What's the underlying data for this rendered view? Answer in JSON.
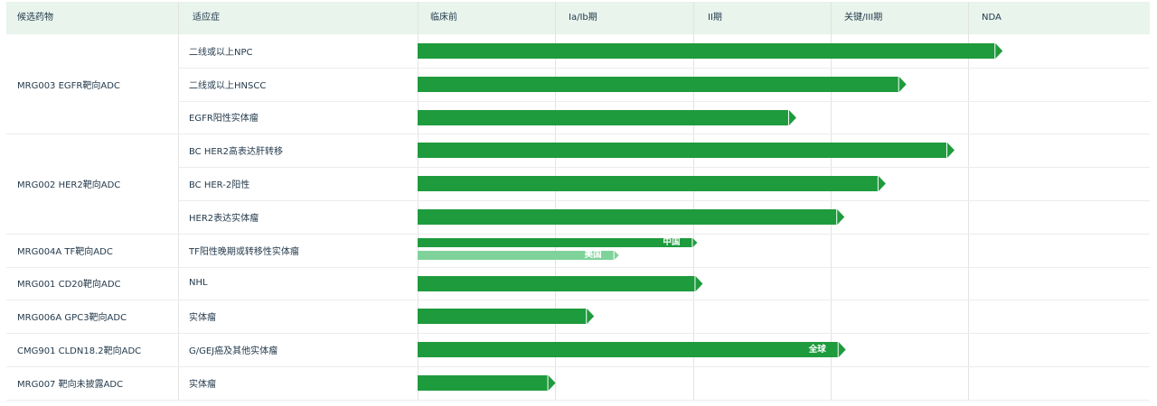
{
  "header": {
    "drug": "候选药物",
    "indication": "适应症",
    "phases": [
      "临床前",
      "Ia/Ib期",
      "II期",
      "关键/III期",
      "NDA"
    ]
  },
  "colors": {
    "primary_bar": "#1e9b3d",
    "secondary_bar": "#7fd39a",
    "header_bg": "#e8f4ec"
  },
  "drugs": [
    {
      "name": "MRG003 EGFR靶向ADC",
      "indications": [
        "二线或以上NPC",
        "二线或以上HNSCC",
        "EGFR阳性实体瘤"
      ]
    },
    {
      "name": "MRG002 HER2靶向ADC",
      "indications": [
        "BC HER2高表达肝转移",
        "BC HER-2阳性",
        "HER2表达实体瘤"
      ]
    },
    {
      "name": "MRG004A TF靶向ADC",
      "indications": [
        "TF阳性晚期或转移性实体瘤"
      ]
    },
    {
      "name": "MRG001 CD20靶向ADC",
      "indications": [
        "NHL"
      ]
    },
    {
      "name": "MRG006A GPC3靶向ADC",
      "indications": [
        "实体瘤"
      ]
    },
    {
      "name": "CMG901 CLDN18.2靶向ADC",
      "indications": [
        "G/GEJ癌及其他实体瘤"
      ]
    },
    {
      "name": "MRG007 靶向未披露ADC",
      "indications": [
        "实体瘤"
      ]
    }
  ],
  "chart_data": {
    "type": "bar",
    "orientation": "horizontal",
    "stages": [
      "临床前",
      "Ia/Ib期",
      "II期",
      "关键/III期",
      "NDA"
    ],
    "note_unit": "progress measured in stage columns from start of 临床前 (0 to 5)",
    "rows": [
      {
        "drug": "MRG003 EGFR靶向ADC",
        "indication": "二线或以上NPC",
        "bars": [
          {
            "progress": 4.2,
            "series": "primary",
            "label": ""
          }
        ]
      },
      {
        "drug": "MRG003 EGFR靶向ADC",
        "indication": "二线或以上HNSCC",
        "bars": [
          {
            "progress": 3.5,
            "series": "primary",
            "label": ""
          }
        ]
      },
      {
        "drug": "MRG003 EGFR靶向ADC",
        "indication": "EGFR阳性实体瘤",
        "bars": [
          {
            "progress": 2.7,
            "series": "primary",
            "label": ""
          }
        ]
      },
      {
        "drug": "MRG002 HER2靶向ADC",
        "indication": "BC HER2高表达肝转移",
        "bars": [
          {
            "progress": 3.85,
            "series": "primary",
            "label": ""
          }
        ]
      },
      {
        "drug": "MRG002 HER2靶向ADC",
        "indication": "BC HER-2阳性",
        "bars": [
          {
            "progress": 3.35,
            "series": "primary",
            "label": ""
          }
        ]
      },
      {
        "drug": "MRG002 HER2靶向ADC",
        "indication": "HER2表达实体瘤",
        "bars": [
          {
            "progress": 3.05,
            "series": "primary",
            "label": ""
          }
        ]
      },
      {
        "drug": "MRG004A TF靶向ADC",
        "indication": "TF阳性晚期或转移性实体瘤",
        "bars": [
          {
            "progress": 2.0,
            "series": "primary",
            "label": "中国"
          },
          {
            "progress": 1.43,
            "series": "secondary",
            "label": "美国"
          }
        ]
      },
      {
        "drug": "MRG001 CD20靶向ADC",
        "indication": "NHL",
        "bars": [
          {
            "progress": 2.02,
            "series": "primary",
            "label": ""
          }
        ]
      },
      {
        "drug": "MRG006A GPC3靶向ADC",
        "indication": "实体瘤",
        "bars": [
          {
            "progress": 1.23,
            "series": "primary",
            "label": ""
          }
        ]
      },
      {
        "drug": "CMG901 CLDN18.2靶向ADC",
        "indication": "G/GEJ癌及其他实体瘤",
        "bars": [
          {
            "progress": 3.06,
            "series": "primary",
            "label": "全球"
          }
        ]
      },
      {
        "drug": "MRG007 靶向未披露ADC",
        "indication": "实体瘤",
        "bars": [
          {
            "progress": 0.95,
            "series": "primary",
            "label": ""
          }
        ]
      }
    ]
  }
}
